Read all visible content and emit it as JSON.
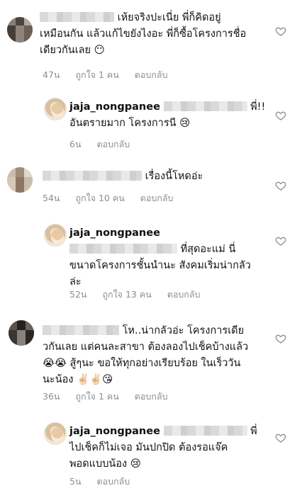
{
  "comments": [
    {
      "text": "เห้ยจริงปะเนี่ย พี่ก็คิดอยู่เหมือนกัน แล้วแก้ไขยังไงอะ พี่ก็ซื้อโครงการชื่อเดียวกันเลย 🙂",
      "line1": "เห้ยจริงปะเนี่ย พี่ก็คิดอยู่",
      "line2": "เหมือนกัน แล้วแก้ไขยังไงอะ พี่ก็ซื้อโครงการชื่อ",
      "line3": "เดียวกันเลย 😶",
      "time": "47น",
      "likes": "ถูกใจ 1 คน",
      "reply": "ตอบกลับ"
    },
    {
      "username": "jaja_nongpanee",
      "line1": "พี่!!",
      "line2": "อันตรายมาก โครงการนี 😢",
      "time": "6น",
      "reply": "ตอบกลับ"
    },
    {
      "line1": "เรื่องนี้โหดอ่ะ",
      "time": "54น",
      "likes": "ถูกใจ 10 คน",
      "reply": "ตอบกลับ"
    },
    {
      "username": "jaja_nongpanee",
      "line1": "ที่สุดอะแม่ นี่",
      "line2": "ขนาดโครงการชั้นนำนะ สังคมเริ่มน่ากลัว",
      "line3": "ล่ะ",
      "time": "52น",
      "likes": "ถูกใจ 13 คน",
      "reply": "ตอบกลับ"
    },
    {
      "line1": "โห..น่ากลัวอ่ะ โครงการเดีย",
      "line2": "วกันเลย แต่คนละสาขา ต้องลองไปเช็คบ้างแล้ว",
      "line3": "😭😭 สู้ๆนะ ขอให้ทุกอย่างเรียบร้อย ในเร็ววัน",
      "line4": "นะน้อง ✌🏻✌🏻😘",
      "time": "36น",
      "likes": "ถูกใจ 1 คน",
      "reply": "ตอบกลับ"
    },
    {
      "username": "jaja_nongpanee",
      "line1": "พี่",
      "line2": "ไปเช็คก็ไม่เจอ มันปกปิด ต้องรอแจ๊ค",
      "line3": "พอดแบบน้อง 😢",
      "time": "5น",
      "reply": "ตอบกลับ"
    }
  ],
  "icons": {
    "like": "heart-outline-icon"
  },
  "colors": {
    "text": "#111111",
    "meta": "#8e8e8e",
    "heart": "#8e8e8e"
  }
}
